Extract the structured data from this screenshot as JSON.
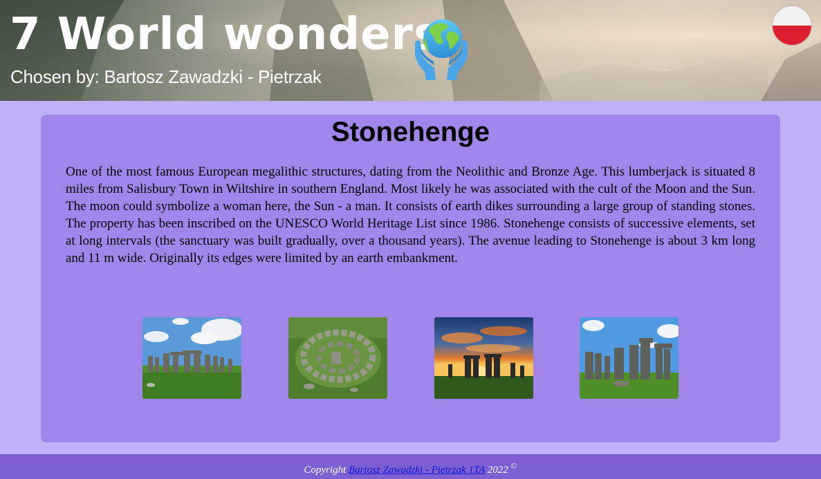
{
  "header": {
    "title": "7 World wonders",
    "subtitle": "Chosen by: Bartosz Zawadzki - Pietrzak",
    "globe_icon": "globe-in-hands-icon",
    "language_flag": "poland-flag-icon"
  },
  "main": {
    "title": "Stonehenge",
    "description": "One of the most famous European megalithic structures, dating from the Neolithic and Bronze Age. This lumberjack is situated 8 miles from Salisbury Town in Wiltshire in southern England. Most likely he was associated with the cult of the Moon and the Sun. The moon could symbolize a woman here, the Sun - a man. It consists of earth dikes surrounding a large group of standing stones. The property has been inscribed on the UNESCO World Heritage List since 1986. Stonehenge consists of successive elements, set at long intervals (the sanctuary was built gradually, over a thousand years). The avenue leading to Stonehenge is about 3 km long and 11 m wide. Originally its edges were limited by an earth embankment.",
    "gallery": [
      {
        "name": "stonehenge-photo-1"
      },
      {
        "name": "stonehenge-photo-2"
      },
      {
        "name": "stonehenge-photo-3"
      },
      {
        "name": "stonehenge-photo-4"
      }
    ]
  },
  "footer": {
    "prefix": "Copyright",
    "author_link": "Bartosz Zawadzki - Pietrzak 1TA",
    "year": "2022",
    "copyright_symbol": "©"
  },
  "colors": {
    "page_background": "#c0b1f7",
    "card_background": "#a086ea",
    "footer_background": "#7e5fd3",
    "link": "#0c17d8",
    "flag_red": "#dc1f2f"
  }
}
